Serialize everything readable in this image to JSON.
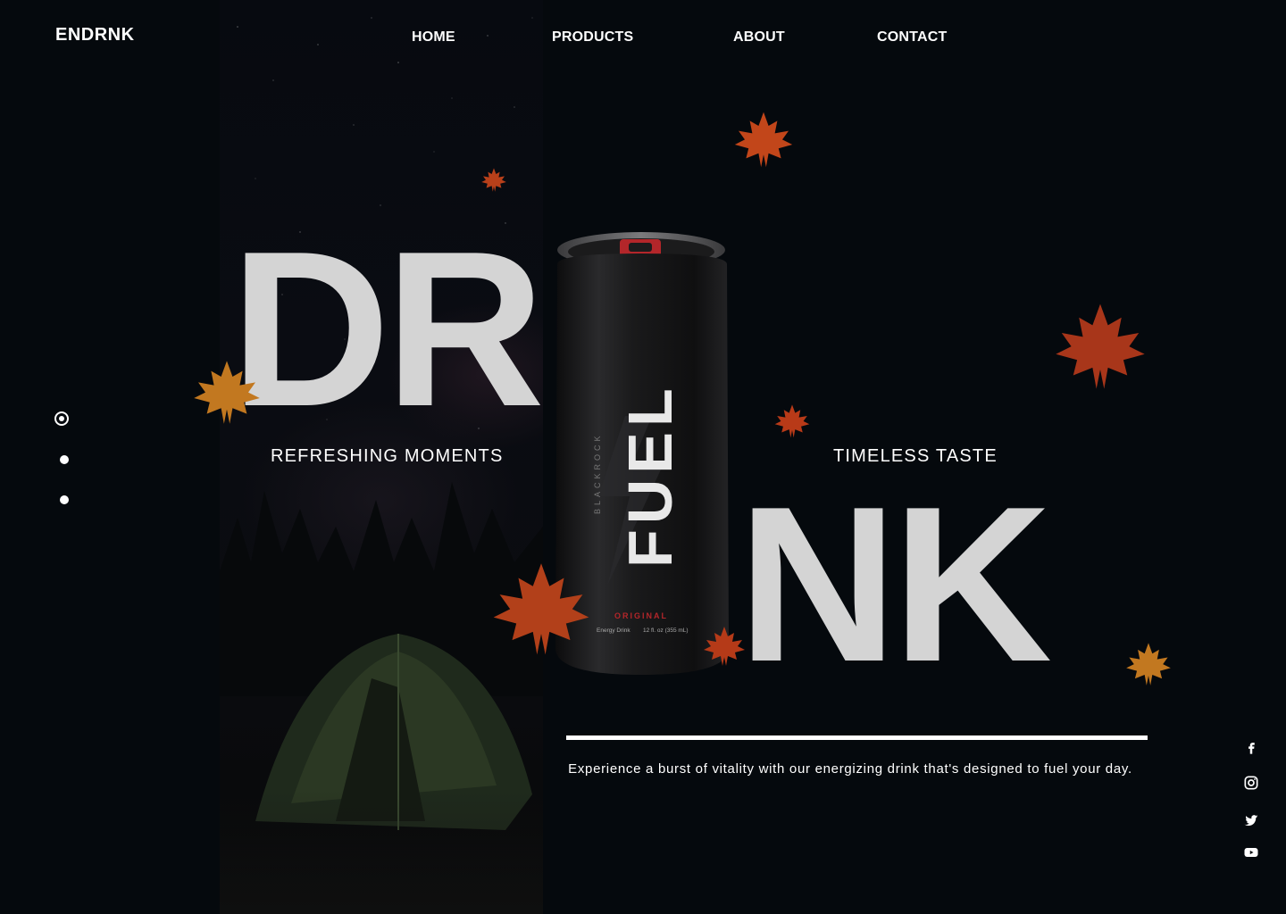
{
  "brand": {
    "logo": "ENDRNK"
  },
  "nav": {
    "items": [
      {
        "label": "HOME"
      },
      {
        "label": "PRODUCTS"
      },
      {
        "label": "ABOUT"
      },
      {
        "label": "CONTACT"
      }
    ]
  },
  "hero": {
    "word_left": "DR",
    "word_right": "NK",
    "tagline_left": "REFRESHING MOMENTS",
    "tagline_right": "TIMELESS TASTE",
    "description": "Experience a burst of vitality with our energizing drink that's designed to fuel your day."
  },
  "product_can": {
    "brand_word": "FUEL",
    "sub_brand": "BLACKROCK",
    "flavor": "ORIGINAL",
    "type": "Energy Drink",
    "volume": "12 fl. oz (355 mL)"
  },
  "slider": {
    "count": 3,
    "active_index": 0
  },
  "social": [
    "facebook-icon",
    "instagram-icon",
    "twitter-icon",
    "youtube-icon"
  ],
  "colors": {
    "background": "#05090d",
    "text": "#ffffff",
    "big_text": "#d4d4d4",
    "can_accent": "#b3262a",
    "leaf": "#c2461a"
  }
}
